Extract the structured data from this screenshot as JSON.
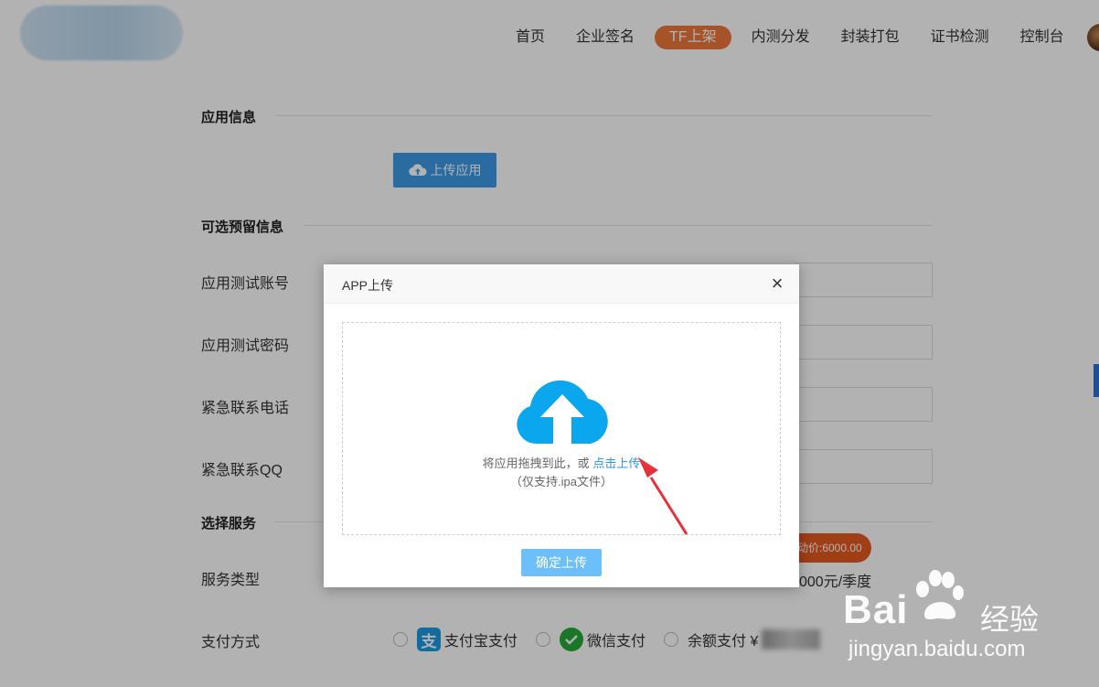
{
  "header": {
    "nav": [
      {
        "label": "首页",
        "active": false
      },
      {
        "label": "企业签名",
        "active": false
      },
      {
        "label": "TF上架",
        "active": true
      },
      {
        "label": "内测分发",
        "active": false
      },
      {
        "label": "封装打包",
        "active": false
      },
      {
        "label": "证书检测",
        "active": false
      },
      {
        "label": "控制台",
        "active": false
      }
    ]
  },
  "form": {
    "app_info_title": "应用信息",
    "upload_app_label": "上传应用",
    "optional_title": "可选预留信息",
    "fields": [
      {
        "label": "应用测试账号"
      },
      {
        "label": "应用测试密码"
      },
      {
        "label": "紧急联系电话"
      },
      {
        "label": "紧急联系QQ"
      }
    ],
    "service_title": "选择服务",
    "service_type_label": "服务类型",
    "promo_text": "动价:6000.00",
    "price_text": "000元/季度",
    "payment_label": "支付方式",
    "payment_options": [
      {
        "label": "支付宝支付",
        "icon": "alipay-icon",
        "icon_glyph": "支"
      },
      {
        "label": "微信支付",
        "icon": "wechat-pay-icon"
      },
      {
        "label": "余额支付 ¥",
        "icon": "none"
      }
    ]
  },
  "modal": {
    "title": "APP上传",
    "close_glyph": "×",
    "drop_text": "将应用拖拽到此，或",
    "drop_link": "点击上传",
    "drop_sub": "（仅支持.ipa文件）",
    "confirm_label": "确定上传"
  },
  "watermark": {
    "brand": "Bai",
    "brand_suffix": "经验",
    "url": "jingyan.baidu.com"
  },
  "colors": {
    "accent": "#3d9be9",
    "nav_active": "#f0783c",
    "cloud": "#0aa6ee",
    "annotation_arrow": "#e8303a",
    "promo": "#e65a1f"
  }
}
